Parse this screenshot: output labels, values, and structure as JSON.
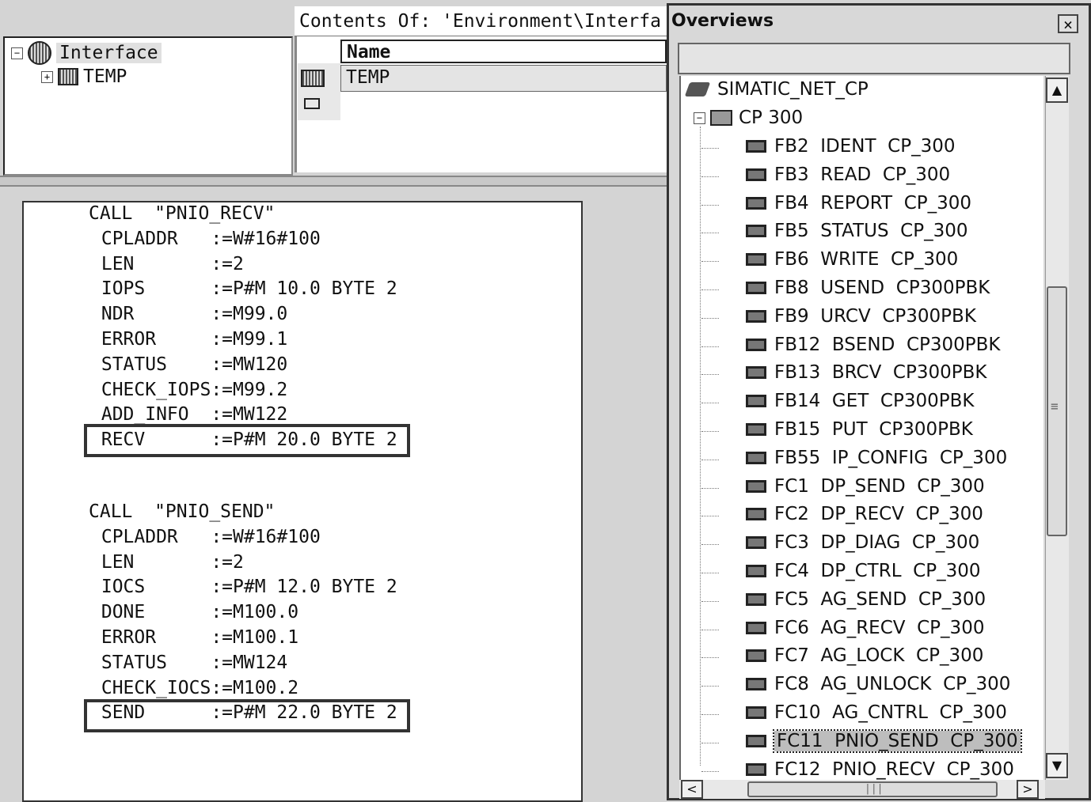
{
  "tree": {
    "root_label": "Interface",
    "child_label": "TEMP"
  },
  "contents": {
    "header": "Contents Of: 'Environment\\Interfa",
    "column_name": "Name",
    "row_label": "TEMP"
  },
  "code": {
    "block1": [
      "CALL  \"PNIO_RECV\"",
      " CPLADDR   :=W#16#100",
      " LEN       :=2",
      " IOPS      :=P#M 10.0 BYTE 2",
      " NDR       :=M99.0",
      " ERROR     :=M99.1",
      " STATUS    :=MW120",
      " CHECK_IOPS:=M99.2",
      " ADD_INFO  :=MW122",
      " RECV      :=P#M 20.0 BYTE 2"
    ],
    "block2": [
      "CALL  \"PNIO_SEND\"",
      " CPLADDR   :=W#16#100",
      " LEN       :=2",
      " IOCS      :=P#M 12.0 BYTE 2",
      " DONE      :=M100.0",
      " ERROR     :=M100.1",
      " STATUS    :=MW124",
      " CHECK_IOCS:=M100.2",
      " SEND      :=P#M 22.0 BYTE 2"
    ]
  },
  "overviews": {
    "title": "Overviews",
    "close": "×",
    "root": "SIMATIC_NET_CP",
    "folder": "CP 300",
    "items": [
      "FB2  IDENT  CP_300",
      "FB3  READ  CP_300",
      "FB4  REPORT  CP_300",
      "FB5  STATUS  CP_300",
      "FB6  WRITE  CP_300",
      "FB8  USEND  CP300PBK",
      "FB9  URCV  CP300PBK",
      "FB12  BSEND  CP300PBK",
      "FB13  BRCV  CP300PBK",
      "FB14  GET  CP300PBK",
      "FB15  PUT  CP300PBK",
      "FB55  IP_CONFIG  CP_300",
      "FC1  DP_SEND  CP_300",
      "FC2  DP_RECV  CP_300",
      "FC3  DP_DIAG  CP_300",
      "FC4  DP_CTRL  CP_300",
      "FC5  AG_SEND  CP_300",
      "FC6  AG_RECV  CP_300",
      "FC7  AG_LOCK  CP_300",
      "FC8  AG_UNLOCK  CP_300",
      "FC10  AG_CNTRL  CP_300",
      "FC11  PNIO_SEND  CP_300",
      "FC12  PNIO_RECV  CP_300"
    ],
    "selected_index": 21,
    "scroll_up": "▲",
    "scroll_down": "▼",
    "scroll_left": "<",
    "scroll_right": ">",
    "vgrip": "≡",
    "hgrip": "|||"
  }
}
